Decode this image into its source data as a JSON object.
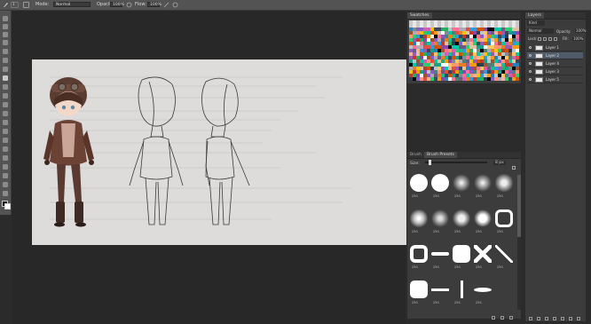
{
  "options_bar": {
    "brush_size": "1",
    "mode_label": "Mode:",
    "mode_value": "Normal",
    "opacity_label": "Opacity:",
    "opacity_value": "100%",
    "flow_label": "Flow:",
    "flow_value": "100%"
  },
  "swatches": {
    "tab_label": "Swatches"
  },
  "brush_panel": {
    "tab_brush": "Brush",
    "tab_presets": "Brush Presets",
    "size_label": "Size:",
    "size_value": "8 px",
    "presets": [
      {
        "num": "250"
      },
      {
        "num": "250"
      },
      {
        "num": "250"
      },
      {
        "num": "250"
      },
      {
        "num": "250"
      },
      {
        "num": "250"
      },
      {
        "num": "250"
      },
      {
        "num": "250"
      },
      {
        "num": "250"
      },
      {
        "num": "250"
      },
      {
        "num": "250"
      },
      {
        "num": "250"
      },
      {
        "num": "250"
      },
      {
        "num": "250"
      },
      {
        "num": "250"
      },
      {
        "num": "250"
      },
      {
        "num": "250"
      },
      {
        "num": "254"
      },
      {
        "num": "254"
      }
    ]
  },
  "layers_panel": {
    "tab_label": "Layers",
    "kind_label": "Kind",
    "blend_mode": "Normal",
    "opacity_label": "Opacity:",
    "opacity_value": "100%",
    "lock_label": "Lock:",
    "fill_label": "Fill:",
    "fill_value": "100%",
    "layers": [
      {
        "name": "Layer 1"
      },
      {
        "name": "Layer 2"
      },
      {
        "name": "Layer 4"
      },
      {
        "name": "Layer 3"
      },
      {
        "name": "Layer 5"
      }
    ]
  }
}
